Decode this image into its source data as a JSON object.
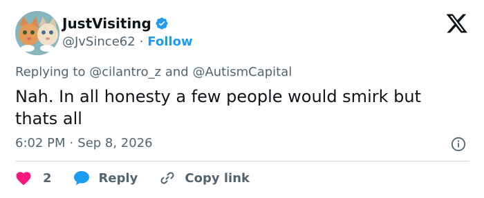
{
  "user": {
    "display_name": "JustVisiting",
    "handle": "@JvSince62",
    "separator": "·",
    "follow_label": "Follow"
  },
  "reply_to": {
    "prefix": "Replying to",
    "mention_1": "@cilantro_z",
    "conjunction": "and",
    "mention_2": "@AutismCapital"
  },
  "tweet": {
    "text": "Nah. In all honesty a few people would smirk but thats all",
    "time": "6:02 PM",
    "separator": "·",
    "date": "Sep 8, 2026"
  },
  "actions": {
    "like_count": "2",
    "reply_label": "Reply",
    "copy_link_label": "Copy link"
  },
  "colors": {
    "accent": "#1d9bf0",
    "like": "#f91880",
    "secondary_text": "#536471",
    "divider": "#cfd9de"
  },
  "icons": {
    "verified": "verified-badge-icon",
    "brand": "x-logo-icon",
    "info": "info-icon",
    "like": "heart-icon",
    "reply": "speech-bubble-icon",
    "copy_link": "link-icon"
  }
}
